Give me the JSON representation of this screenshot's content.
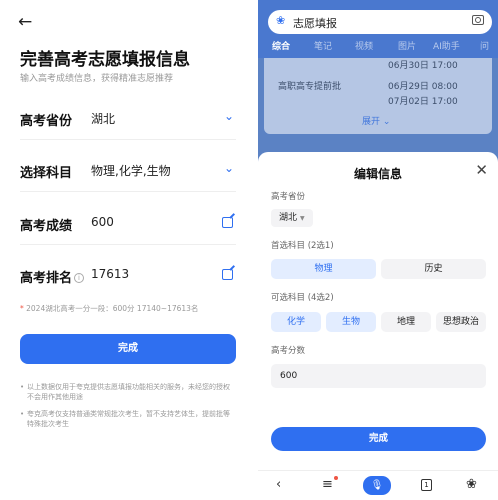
{
  "left": {
    "title": "完善高考志愿填报信息",
    "subtitle": "输入高考成绩信息，获得精准志愿推荐",
    "rows": [
      {
        "label": "高考省份",
        "value": "湖北"
      },
      {
        "label": "选择科目",
        "value": "物理,化学,生物"
      },
      {
        "label": "高考成绩",
        "value": "600"
      },
      {
        "label": "高考排名",
        "value": "17613"
      }
    ],
    "rank_info": "i",
    "note": "2024湖北高考一分一段：600分 17140~17613名",
    "done_label": "完成",
    "footnotes": [
      "以上数据仅用于夸克提供志愿填报功能相关的服务，未经您的授权不会用作其他用途",
      "夸克高考仅支持普通类常规批次考生，暂不支持艺体生，提前批等特殊批次考生"
    ]
  },
  "right": {
    "search_query": "志愿填报",
    "tabs": [
      "综合",
      "笔记",
      "视频",
      "图片",
      "AI助手",
      "问"
    ],
    "card": {
      "line1": "06月30日 17:00",
      "line2_left": "高职高专提前批",
      "line2_right": "06月29日 08:00",
      "line3_right": "07月02日 17:00",
      "more": "展开"
    },
    "sheet": {
      "title": "编辑信息",
      "province_label": "高考省份",
      "province_value": "湖北",
      "first_label": "首选科目 (2选1)",
      "first_options": [
        "物理",
        "历史"
      ],
      "second_label": "可选科目 (4选2)",
      "second_options": [
        "化学",
        "生物",
        "地理",
        "思想政治"
      ],
      "score_label": "高考分数",
      "score_value": "600",
      "done_label": "完成"
    },
    "nav": [
      "back-icon",
      "menu-icon",
      "mic-icon",
      "tabs-count-icon",
      "paw-icon"
    ],
    "tabs_count": "1"
  },
  "colors": {
    "accent": "#2f6ff0",
    "selected_bg": "#e3edff",
    "overlay": "#5b82c4"
  }
}
